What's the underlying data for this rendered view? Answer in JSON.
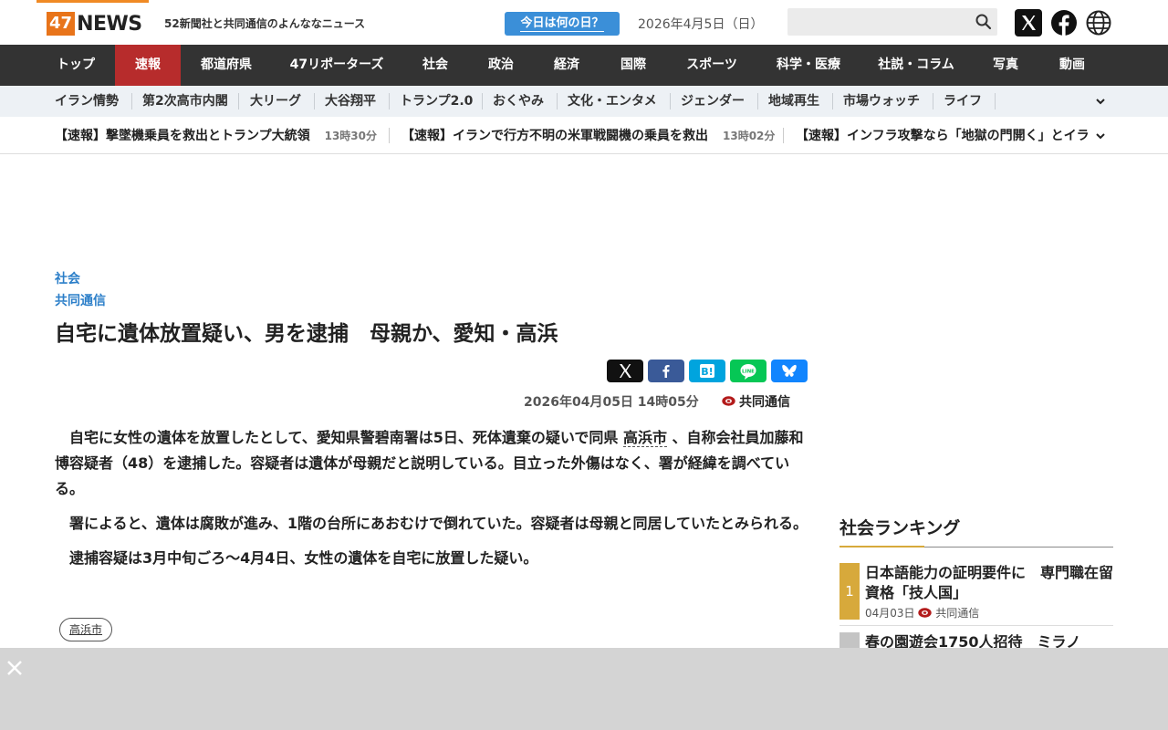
{
  "header": {
    "logo_number": "47",
    "logo_text": "NEWS",
    "tagline": "52新聞社と共同通信のよんななニュース",
    "today_button": "今日は何の日？",
    "date": "2026年4月5日（日）",
    "search_placeholder": ""
  },
  "main_nav": [
    "トップ",
    "速報",
    "都道府県",
    "47リポーターズ",
    "社会",
    "政治",
    "経済",
    "国際",
    "スポーツ",
    "科学・医療",
    "社説・コラム",
    "写真",
    "動画"
  ],
  "sub_nav": [
    "イラン情勢",
    "第2次高市内閣",
    "大リーグ",
    "大谷翔平",
    "トランプ2.0",
    "おくやみ",
    "文化・エンタメ",
    "ジェンダー",
    "地域再生",
    "市場ウォッチ",
    "ライフ"
  ],
  "ticker": [
    {
      "text": "【速報】撃墜機乗員を救出とトランプ大統領",
      "time": "13時30分"
    },
    {
      "text": "【速報】イランで行方不明の米軍戦闘機の乗員を救出",
      "time": "13時02分"
    },
    {
      "text": "【速報】インフラ攻撃なら「地獄の門開く」とイラン",
      "time": ""
    }
  ],
  "article": {
    "category": "社会",
    "source_label": "共同通信",
    "title": "自宅に遺体放置疑い、男を逮捕　母親か、愛知・高浜",
    "datetime": "2026年04月05日 14時05分",
    "source": "共同通信",
    "p1_before": "自宅に女性の遺体を放置したとして、愛知県警碧南署は5日、死体遺棄の疑いで同県 ",
    "p1_link": "高浜市",
    "p1_after": " 、自称会社員加藤和博容疑者（48）を逮捕した。容疑者は遺体が母親だと説明している。目立った外傷はなく、署が経緯を調べている。",
    "p2": "署によると、遺体は腐敗が進み、1階の台所にあおむけで倒れていた。容疑者は母親と同居していたとみられる。",
    "p3": "逮捕容疑は3月中旬ごろ～4月4日、女性の遺体を自宅に放置した疑い。",
    "tag": "高浜市"
  },
  "ranking": {
    "title": "社会ランキング",
    "items": [
      {
        "rank": "1",
        "text": "日本語能力の証明要件に　専門職在留資格「技人国」",
        "date": "04月03日",
        "source": "共同通信"
      },
      {
        "rank": "2",
        "text": "春の園遊会1750人招待　ミラノ",
        "date": "",
        "source": ""
      }
    ]
  },
  "colors": {
    "brand_orange": "#e8741a",
    "nav_dark": "#333333",
    "nav_active": "#b72c2c",
    "link_blue": "#2c7fc9",
    "rank_gold": "#d7a93b"
  }
}
